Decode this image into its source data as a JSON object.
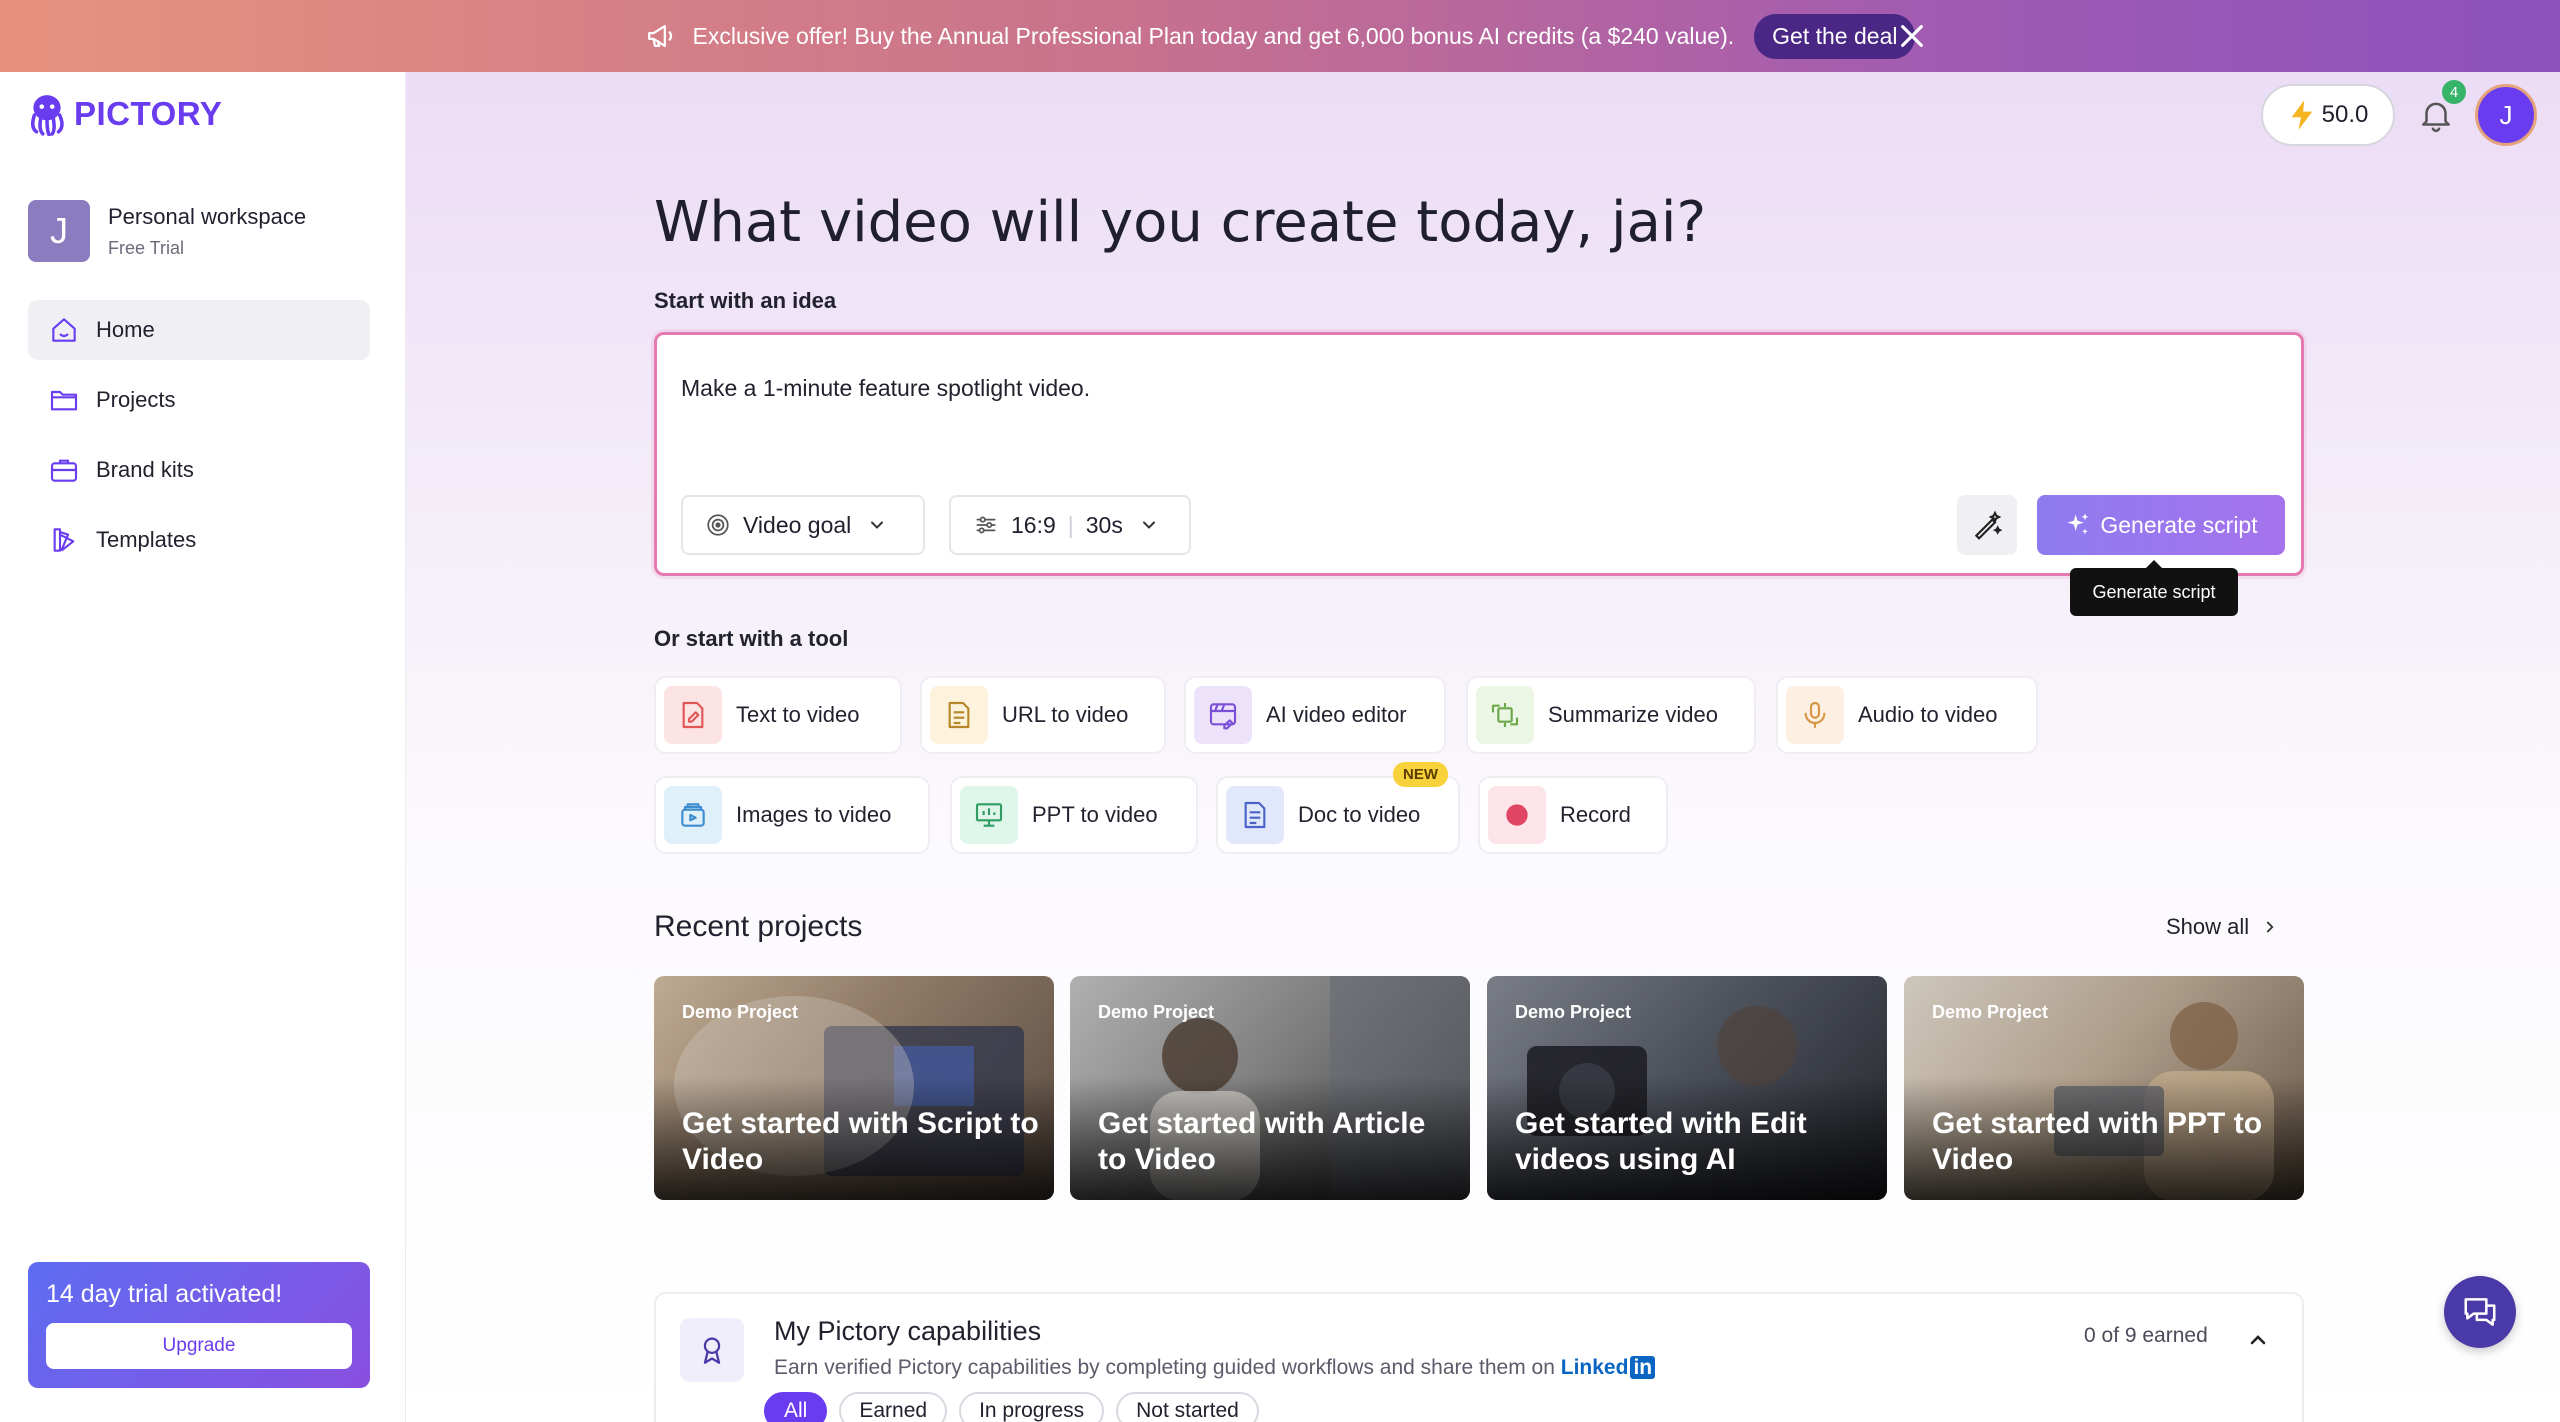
{
  "banner": {
    "text": "Exclusive offer! Buy the Annual Professional Plan today and get 6,000 bonus AI credits (a $240 value).",
    "cta": "Get the deal"
  },
  "logo": {
    "text": "PICTORY"
  },
  "workspace": {
    "avatar": "J",
    "name": "Personal workspace",
    "plan": "Free Trial"
  },
  "nav": [
    {
      "label": "Home",
      "icon": "home-icon",
      "active": true
    },
    {
      "label": "Projects",
      "icon": "folder-icon"
    },
    {
      "label": "Brand kits",
      "icon": "briefcase-icon"
    },
    {
      "label": "Templates",
      "icon": "templates-icon"
    }
  ],
  "trial": {
    "title": "14 day trial activated!",
    "cta": "Upgrade"
  },
  "topbar": {
    "credits": "50.0",
    "notifications": "4",
    "user_initial": "J"
  },
  "main": {
    "heading": "What video will you create today, jai?",
    "idea_label": "Start with an idea",
    "idea_text": "Make a 1-minute feature spotlight video.",
    "video_goal": "Video goal",
    "aspect": "16:9",
    "duration": "30s",
    "generate": "Generate script",
    "tooltip": "Generate script",
    "tools_label": "Or start with a tool",
    "tools": [
      {
        "label": "Text to video",
        "icon": "text-to-video-icon"
      },
      {
        "label": "URL to video",
        "icon": "url-icon"
      },
      {
        "label": "AI video editor",
        "icon": "ai-editor-icon"
      },
      {
        "label": "Summarize video",
        "icon": "summarize-icon"
      },
      {
        "label": "Audio to video",
        "icon": "microphone-icon"
      },
      {
        "label": "Images to video",
        "icon": "images-icon"
      },
      {
        "label": "PPT to video",
        "icon": "ppt-icon"
      },
      {
        "label": "Doc to video",
        "icon": "doc-icon",
        "badge": "NEW"
      },
      {
        "label": "Record",
        "icon": "record-icon"
      }
    ],
    "recent_title": "Recent projects",
    "show_all": "Show all",
    "projects": [
      {
        "tag": "Demo Project",
        "title": "Get started with Script to Video"
      },
      {
        "tag": "Demo Project",
        "title": "Get started with Article to Video"
      },
      {
        "tag": "Demo Project",
        "title": "Get started with Edit videos using AI"
      },
      {
        "tag": "Demo Project",
        "title": "Get started with PPT to Video"
      }
    ],
    "capabilities": {
      "title": "My Pictory capabilities",
      "subtitle": "Earn verified Pictory capabilities by completing guided workflows and share them on",
      "linkedin": "Linked",
      "linkedin_in": "in",
      "earned": "0 of 9 earned",
      "filters": [
        "All",
        "Earned",
        "In progress",
        "Not started"
      ]
    }
  },
  "colors": {
    "accent": "#6a3cf0",
    "banner_start": "#e8927e",
    "banner_end": "#8c52bd"
  }
}
